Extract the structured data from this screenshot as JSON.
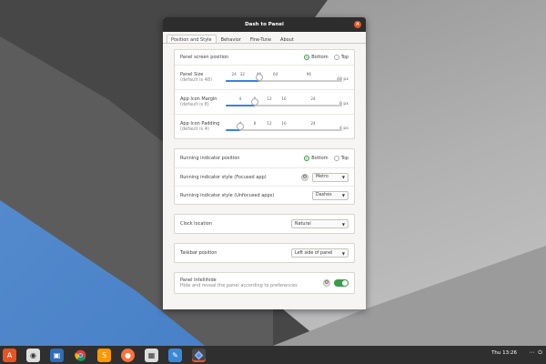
{
  "window": {
    "title": "Dash to Panel",
    "tabs": [
      {
        "label": "Position and Style",
        "active": true
      },
      {
        "label": "Behavior",
        "active": false
      },
      {
        "label": "Fine-Tune",
        "active": false
      },
      {
        "label": "About",
        "active": false
      }
    ]
  },
  "position_group": {
    "screen_position": {
      "label": "Panel screen position",
      "options": [
        "Bottom",
        "Top"
      ],
      "selected": "Bottom"
    },
    "panel_size": {
      "label": "Panel Size",
      "sub": "(default is 48)",
      "ticks": [
        "24",
        "32",
        "48",
        "64",
        "96"
      ],
      "value_text": "48 px",
      "value": 48,
      "min": 16,
      "max": 128
    },
    "icon_margin": {
      "label": "App Icon Margin",
      "sub": "(default is 8)",
      "ticks": [
        "4",
        "8",
        "12",
        "16",
        "24"
      ],
      "value_text": "8 px",
      "value": 8,
      "min": 0,
      "max": 32
    },
    "icon_padding": {
      "label": "App Icon Padding",
      "sub": "(default is 4)",
      "ticks": [
        "4",
        "8",
        "12",
        "16",
        "24"
      ],
      "value_text": "4 px",
      "value": 4,
      "min": 0,
      "max": 32
    }
  },
  "indicator_group": {
    "position": {
      "label": "Running indicator position",
      "options": [
        "Bottom",
        "Top"
      ],
      "selected": "Bottom"
    },
    "focused": {
      "label": "Running indicator style (Focused app)",
      "value": "Metro"
    },
    "unfocused": {
      "label": "Running indicator style (Unfocused apps)",
      "value": "Dashes"
    }
  },
  "clock_group": {
    "label": "Clock location",
    "value": "Natural"
  },
  "taskbar_group": {
    "label": "Taskbar position",
    "value": "Left side of panel"
  },
  "intellihide_group": {
    "label": "Panel Intellihide",
    "sub": "Hide and reveal the panel according to preferences",
    "enabled": true
  },
  "taskbar": {
    "clock": "Thu 13:26",
    "icons": [
      "ubuntu-software-icon",
      "disks-icon",
      "virtualbox-icon",
      "chrome-icon",
      "sublime-icon",
      "firefox-icon",
      "files-icon",
      "text-editor-icon",
      "dash-to-panel-icon"
    ]
  },
  "colors": {
    "accent_green": "#3a9b4a",
    "slider_blue": "#3584e4",
    "close_orange": "#e9541f",
    "taskbar": "#2f2f2f"
  }
}
